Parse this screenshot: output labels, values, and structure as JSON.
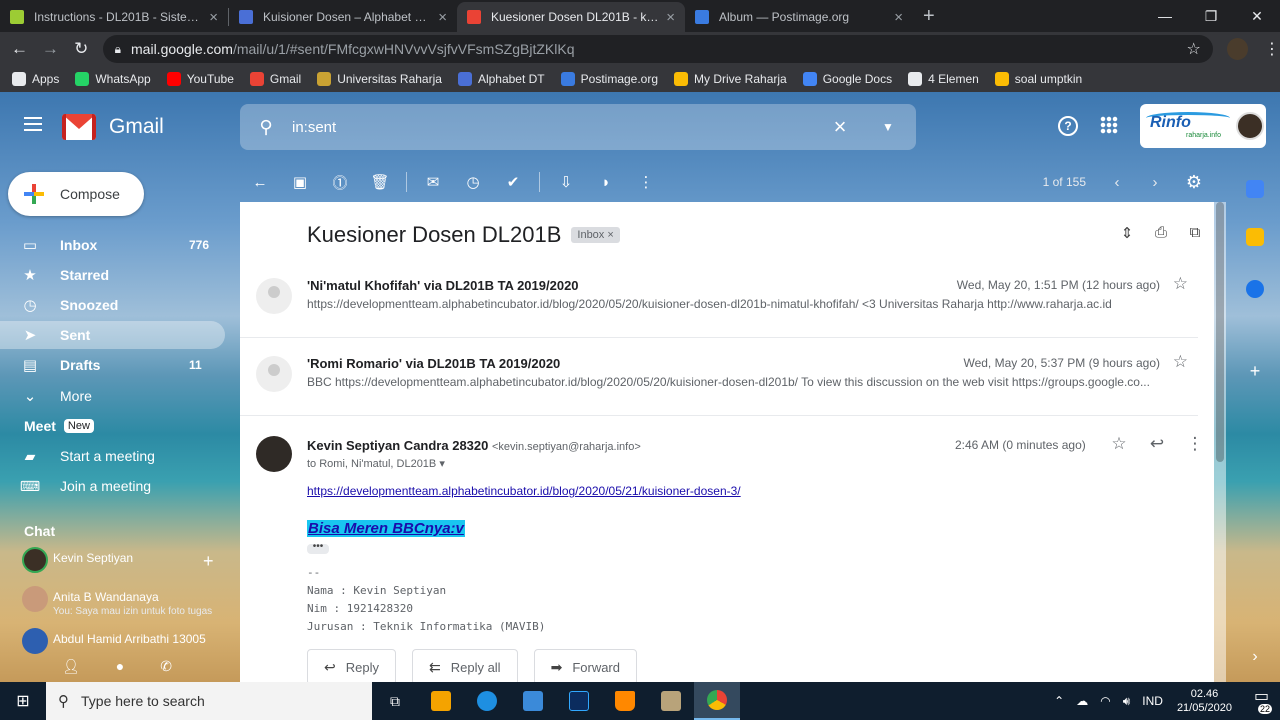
{
  "browser": {
    "tabs": [
      {
        "label": "Instructions - DL201B - Sistem Ba",
        "color": "#9ccc34"
      },
      {
        "label": "Kuisioner Dosen – Alphabet Deve",
        "color": "#4a6fd6"
      },
      {
        "label": "Kuesioner Dosen DL201B - kevin.",
        "color": "#ea4335"
      },
      {
        "label": "Album — Postimage.org",
        "color": "#3a7be0"
      }
    ],
    "url_host": "mail.google.com",
    "url_path": "/mail/u/1/#sent/FMfcgxwHNVvvVsjfvVFsmSZgBjtZKlKq",
    "bookmarks": [
      {
        "label": "Apps",
        "color": "#e8eaed"
      },
      {
        "label": "WhatsApp",
        "color": "#25d366"
      },
      {
        "label": "YouTube",
        "color": "#ff0000"
      },
      {
        "label": "Gmail",
        "color": "#ea4335"
      },
      {
        "label": "Universitas Raharja",
        "color": "#c9a233"
      },
      {
        "label": "Alphabet DT",
        "color": "#4a6fd6"
      },
      {
        "label": "Postimage.org",
        "color": "#3a7be0"
      },
      {
        "label": "My Drive Raharja",
        "color": "#fbbc04"
      },
      {
        "label": "Google Docs",
        "color": "#4285f4"
      },
      {
        "label": "4 Elemen",
        "color": "#e8eaed"
      },
      {
        "label": "soal umptkin",
        "color": "#fbbc04"
      }
    ]
  },
  "gmail": {
    "wordmark": "Gmail",
    "search_query": "in:sent",
    "account_logo": "Rinfo",
    "account_logo_sub": "raharja.info"
  },
  "sidebar": {
    "compose": "Compose",
    "items": [
      {
        "label": "Inbox",
        "count": "776",
        "icon": "▭"
      },
      {
        "label": "Starred",
        "count": "",
        "icon": "★"
      },
      {
        "label": "Snoozed",
        "count": "",
        "icon": "◷"
      },
      {
        "label": "Sent",
        "count": "",
        "icon": "➤"
      },
      {
        "label": "Drafts",
        "count": "11",
        "icon": "▤"
      },
      {
        "label": "More",
        "count": "",
        "icon": "⌄"
      }
    ],
    "meet_heading": "Meet",
    "meet_badge": "New",
    "meet_items": [
      {
        "label": "Start a meeting"
      },
      {
        "label": "Join a meeting"
      }
    ],
    "chat_heading": "Chat",
    "chat_users": [
      {
        "name": "Kevin Septiyan",
        "status": ""
      },
      {
        "name": "Anita B Wandanaya",
        "status": "You: Saya mau izin untuk foto tugas"
      },
      {
        "name": "Abdul Hamid Arribathi 13005",
        "status": ""
      }
    ]
  },
  "thread": {
    "pager": "1 of 155",
    "subject": "Kuesioner Dosen DL201B",
    "label": "Inbox",
    "label_close": "×",
    "messages": [
      {
        "sender": "'Ni'matul Khofifah' via DL201B TA 2019/2020",
        "date": "Wed, May 20, 1:51 PM (12 hours ago)",
        "snippet": "https://developmentteam.alphabetincubator.id/blog/2020/05/20/kuisioner-dosen-dl201b-nimatul-khofifah/ <3 Universitas Raharja http://www.raharja.ac.id"
      },
      {
        "sender": "'Romi Romario' via DL201B TA 2019/2020",
        "date": "Wed, May 20, 5:37 PM (9 hours ago)",
        "snippet": "BBC https://developmentteam.alphabetincubator.id/blog/2020/05/20/kuisioner-dosen-dl201b/ To view this discussion on the web visit https://groups.google.co..."
      }
    ],
    "expanded": {
      "sender_name": "Kevin Septiyan Candra 28320",
      "sender_email": "<kevin.septiyan@raharja.info>",
      "to": "to Romi, Ni'matul, DL201B",
      "date": "2:46 AM (0 minutes ago)",
      "link": "https://developmentteam.alphabetincubator.id/blog/2020/05/21/kuisioner-dosen-3/",
      "highlight": "Bisa Meren BBCnya:v ",
      "sig_dash": "--",
      "sig_name": "Nama : Kevin Septiyan",
      "sig_nim": "Nim : 1921428320",
      "sig_jurusan": "Jurusan : Teknik Informatika (MAVIB)"
    },
    "reply": "Reply",
    "reply_all": "Reply all",
    "forward": "Forward"
  },
  "taskbar": {
    "search_placeholder": "Type here to search",
    "lang": "IND",
    "time": "02.46",
    "date": "21/05/2020",
    "notif_count": "22"
  }
}
